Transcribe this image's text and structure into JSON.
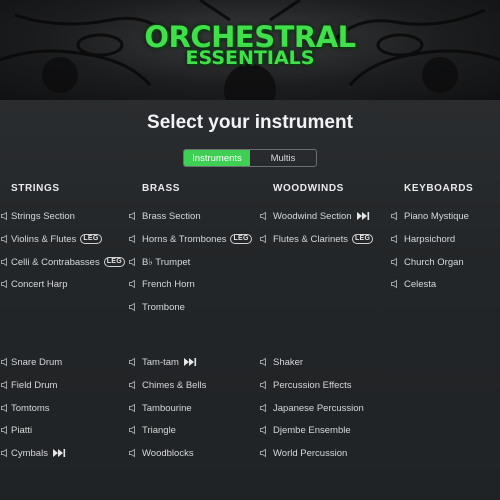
{
  "banner": {
    "title_line1": "ORCHESTRAL",
    "title_line2": "ESSENTIALS",
    "logo_color": "#3fe04a"
  },
  "heading": "Select your instrument",
  "tabs": [
    {
      "label": "Instruments",
      "active": true
    },
    {
      "label": "Multis",
      "active": false
    }
  ],
  "columns": [
    {
      "header": "STRINGS",
      "top_items": [
        {
          "label": "Strings Section",
          "badge": null
        },
        {
          "label": "Violins & Flutes",
          "badge": "LEG"
        },
        {
          "label": "Celli & Contrabasses",
          "badge": "LEG"
        },
        {
          "label": "Concert Harp",
          "badge": null
        }
      ],
      "bottom_items": [
        {
          "label": "Snare Drum",
          "badge": null
        },
        {
          "label": "Field Drum",
          "badge": null
        },
        {
          "label": "Tomtoms",
          "badge": null
        },
        {
          "label": "Piatti",
          "badge": null
        },
        {
          "label": "Cymbals",
          "badge": "play"
        }
      ]
    },
    {
      "header": "BRASS",
      "top_items": [
        {
          "label": "Brass Section",
          "badge": null
        },
        {
          "label": "Horns & Trombones",
          "badge": "LEG"
        },
        {
          "label": "B♭ Trumpet",
          "badge": null
        },
        {
          "label": "French Horn",
          "badge": null
        },
        {
          "label": "Trombone",
          "badge": null
        }
      ],
      "bottom_items": [
        {
          "label": "Tam-tam",
          "badge": "play"
        },
        {
          "label": "Chimes & Bells",
          "badge": null
        },
        {
          "label": "Tambourine",
          "badge": null
        },
        {
          "label": "Triangle",
          "badge": null
        },
        {
          "label": "Woodblocks",
          "badge": null
        }
      ]
    },
    {
      "header": "WOODWINDS",
      "top_items": [
        {
          "label": "Woodwind Section",
          "badge": "play"
        },
        {
          "label": "Flutes & Clarinets",
          "badge": "LEG"
        }
      ],
      "bottom_items": [
        {
          "label": "Shaker",
          "badge": null
        },
        {
          "label": "Percussion Effects",
          "badge": null
        },
        {
          "label": "Japanese Percussion",
          "badge": null
        },
        {
          "label": "Djembe Ensemble",
          "badge": null
        },
        {
          "label": "World Percussion",
          "badge": null
        }
      ]
    },
    {
      "header": "KEYBOARDS",
      "top_items": [
        {
          "label": "Piano Mystique",
          "badge": null
        },
        {
          "label": "Harpsichord",
          "badge": null
        },
        {
          "label": "Church Organ",
          "badge": null
        },
        {
          "label": "Celesta",
          "badge": null
        }
      ],
      "bottom_items": []
    }
  ],
  "icons": {
    "item_icon": "speaker-icon",
    "legato_badge": "LEG",
    "play_badge": "play-forward-icon"
  }
}
